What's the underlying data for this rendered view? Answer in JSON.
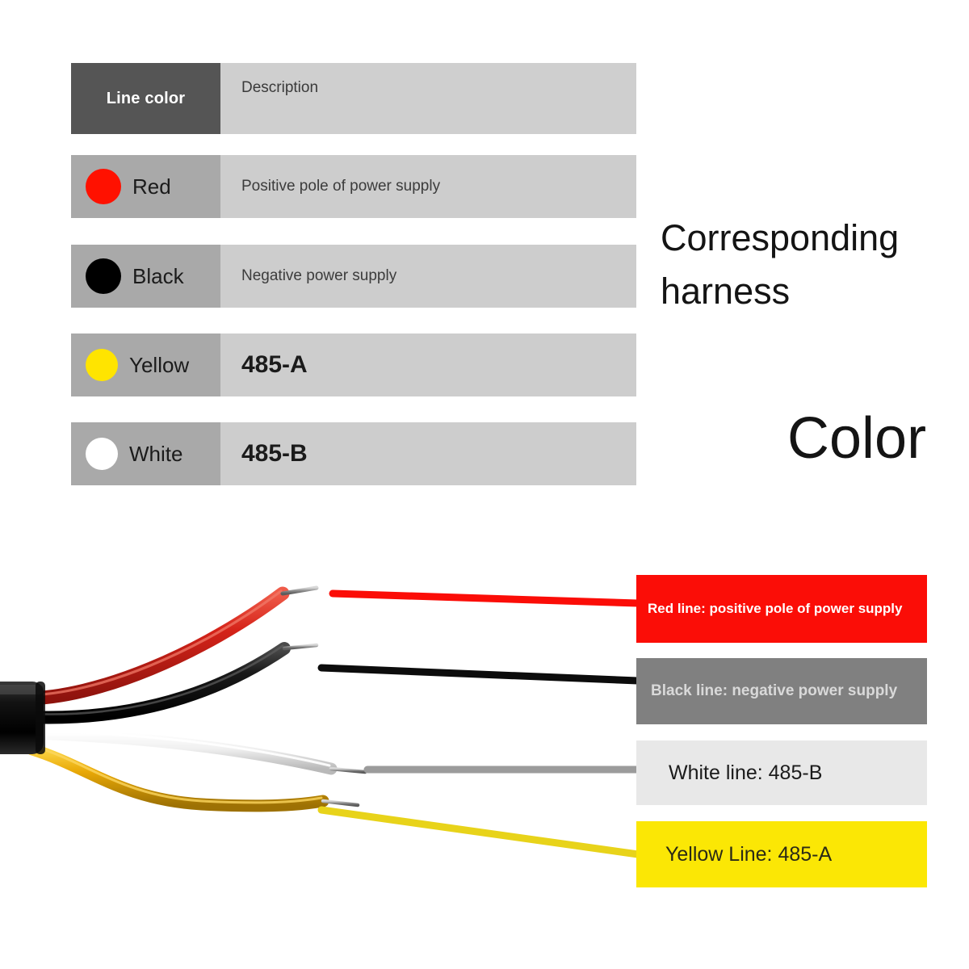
{
  "table": {
    "header": {
      "line_color": "Line color",
      "description": "Description"
    },
    "rows": [
      {
        "swatch": "red-dot-icon",
        "color_hex": "#ff1100",
        "name": "Red",
        "description": "Positive pole of power supply",
        "emphasis": false
      },
      {
        "swatch": "black-dot-icon",
        "color_hex": "#000000",
        "name": "Black",
        "description": "Negative power supply",
        "emphasis": false
      },
      {
        "swatch": "yellow-dot-icon",
        "color_hex": "#ffe400",
        "name": "Yellow",
        "description": "485-A",
        "emphasis": true
      },
      {
        "swatch": "white-dot-icon",
        "color_hex": "#ffffff",
        "name": "White",
        "description": "485-B",
        "emphasis": true
      }
    ]
  },
  "headings": {
    "corresponding_harness": "Corresponding harness",
    "color": "Color"
  },
  "callouts": [
    {
      "key": "red",
      "text": "Red line: positive pole of power supply",
      "bg": "#fb0d07",
      "fg": "#ffffff"
    },
    {
      "key": "black",
      "text": "Black line: negative power supply",
      "bg": "#808080",
      "fg": "#d9d9d9"
    },
    {
      "key": "white",
      "text": "White line: 485-B",
      "bg": "#e8e8e8",
      "fg": "#1b1b1b"
    },
    {
      "key": "yellow",
      "text": "Yellow Line: 485-A",
      "bg": "#fbe705",
      "fg": "#2a2a16"
    }
  ],
  "figure": {
    "name": "wire-harness-photo",
    "wires": [
      {
        "name": "red-wire",
        "color": "#d52319"
      },
      {
        "name": "black-wire",
        "color": "#1a1a1a"
      },
      {
        "name": "white-wire",
        "color": "#efefef"
      },
      {
        "name": "yellow-wire",
        "color": "#e8a806"
      }
    ],
    "leaders": [
      {
        "name": "red-leader-line",
        "color": "#fb0d07"
      },
      {
        "name": "black-leader-line",
        "color": "#0c0c0c"
      },
      {
        "name": "gray-leader-line",
        "color": "#9b9b9b"
      },
      {
        "name": "yellow-leader-line",
        "color": "#e8d31a"
      }
    ]
  }
}
